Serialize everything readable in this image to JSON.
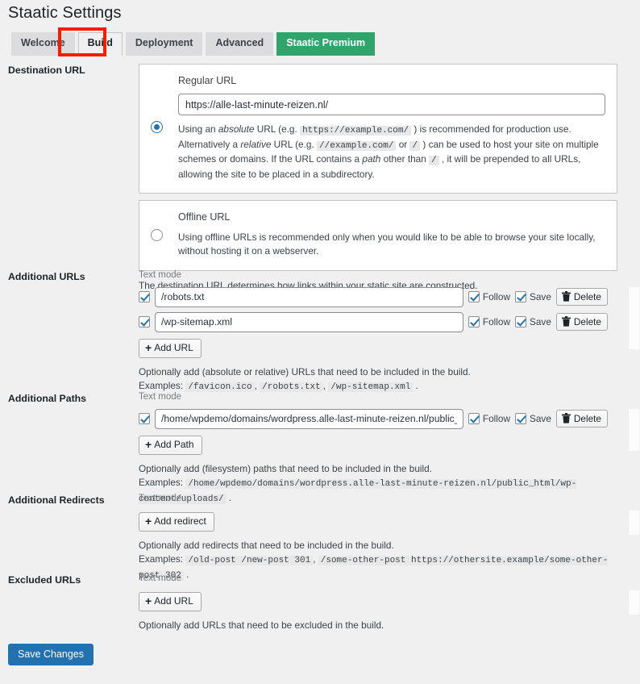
{
  "header": {
    "title": "Staatic Settings"
  },
  "tabs": [
    {
      "label": "Welcome",
      "state": "default"
    },
    {
      "label": "Build",
      "state": "active"
    },
    {
      "label": "Deployment",
      "state": "default"
    },
    {
      "label": "Advanced",
      "state": "default"
    },
    {
      "label": "Staatic Premium",
      "state": "premium"
    }
  ],
  "annotation": {
    "highlight_color": "#f81c04",
    "target": "Build"
  },
  "destination_url": {
    "label": "Destination URL",
    "regular": {
      "heading": "Regular URL",
      "value": "https://alle-last-minute-reizen.nl/",
      "placeholder": "",
      "selected": true,
      "desc_1": "Using an ",
      "desc_abs": "absolute",
      "desc_2": " URL (e.g. ",
      "code_1": "https://example.com/",
      "desc_3": " ) is recommended for production use. Alternatively a ",
      "desc_rel": "relative",
      "desc_4": " URL (e.g. ",
      "code_2": "//example.com/",
      "desc_5": " or ",
      "code_3": "/",
      "desc_6": " ) can be used to host your site on multiple schemes or domains. If the URL contains a ",
      "desc_path": "path",
      "desc_7": " other than ",
      "code_4": "/",
      "desc_8": " , it will be prepended to all URLs, allowing the site to be placed in a subdirectory."
    },
    "offline": {
      "heading": "Offline URL",
      "selected": false,
      "desc": "Using offline URLs is recommended only when you would like to be able to browse your site locally, without hosting it on a webserver."
    },
    "footer_help": "The destination URL determines how links within your static site are constructed."
  },
  "additional_urls": {
    "label": "Additional URLs",
    "text_mode_label": "Text mode",
    "rows": [
      {
        "enabled": true,
        "value": "/robots.txt",
        "follow_label": "Follow",
        "follow": true,
        "save_label": "Save",
        "save": true,
        "delete_label": "Delete"
      },
      {
        "enabled": true,
        "value": "/wp-sitemap.xml",
        "follow_label": "Follow",
        "follow": true,
        "save_label": "Save",
        "save": true,
        "delete_label": "Delete"
      }
    ],
    "add_label": "Add URL",
    "help": "Optionally add (absolute or relative) URLs that need to be included in the build.",
    "examples_label": "Examples:",
    "examples": [
      "/favicon.ico",
      "/robots.txt",
      "/wp-sitemap.xml"
    ]
  },
  "additional_paths": {
    "label": "Additional Paths",
    "text_mode_label": "Text mode",
    "rows": [
      {
        "enabled": true,
        "value": "/home/wpdemo/domains/wordpress.alle-last-minute-reizen.nl/public_html/wp-content/uploads/",
        "follow_label": "Follow",
        "follow": true,
        "save_label": "Save",
        "save": true,
        "delete_label": "Delete"
      }
    ],
    "add_label": "Add Path",
    "help": "Optionally add (filesystem) paths that need to be included in the build.",
    "examples_label": "Examples:",
    "examples": [
      "/home/wpdemo/domains/wordpress.alle-last-minute-reizen.nl/public_html/wp-content/uploads/"
    ]
  },
  "additional_redirects": {
    "label": "Additional Redirects",
    "text_mode_label": "Text mode",
    "add_label": "Add redirect",
    "help": "Optionally add redirects that need to be included in the build.",
    "examples_label": "Examples:",
    "examples": [
      "/old-post /new-post 301",
      "/some-other-post https://othersite.example/some-other-post 302"
    ]
  },
  "excluded_urls": {
    "label": "Excluded URLs",
    "text_mode_label": "Text mode",
    "add_label": "Add URL",
    "help": "Optionally add URLs that need to be excluded in the build."
  },
  "footer": {
    "save_label": "Save Changes",
    "save_color": "#2271b1"
  }
}
